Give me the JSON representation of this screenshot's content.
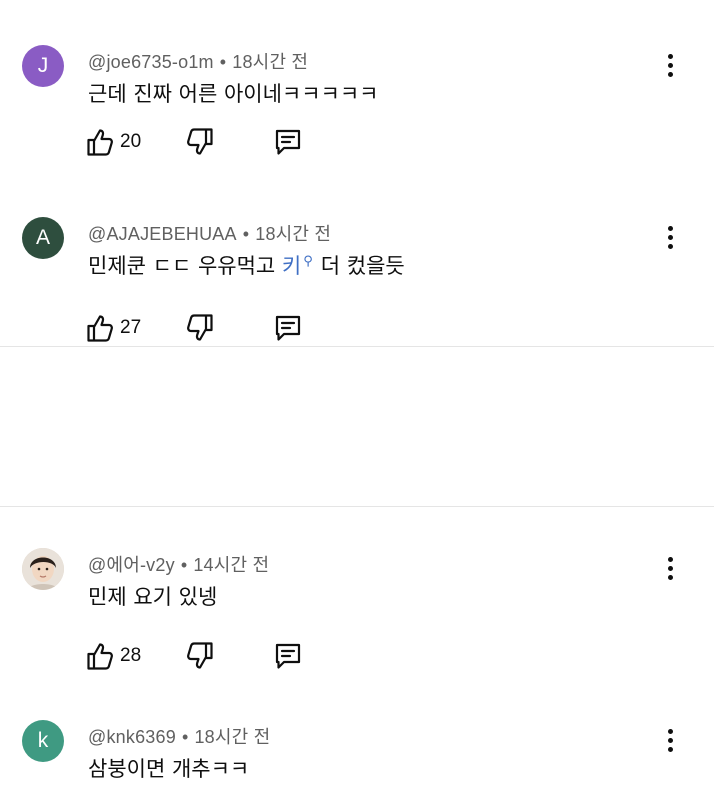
{
  "comments": [
    {
      "initial": "J",
      "avatar_color": "#8a5cc4",
      "handle": "@joe6735-o1m",
      "time": "18시간 전",
      "text": "근데 진짜 어른 아이네ㅋㅋㅋㅋㅋ",
      "likes": "20"
    },
    {
      "initial": "A",
      "avatar_color": "#2e4e3e",
      "handle": "@AJAJEBEHUAA",
      "time": "18시간 전",
      "text_before": "민제쿤 ㄷㄷ 우유먹고 ",
      "text_link": "키",
      "text_after": "더 컸을듯",
      "likes": "27"
    },
    {
      "initial": "",
      "avatar_color": "#d9c9b8",
      "handle": "@에어-v2y",
      "time": "14시간 전",
      "text": "민제 요기 있넹",
      "likes": "28"
    },
    {
      "initial": "k",
      "avatar_color": "#3f9a82",
      "handle": "@knk6369",
      "time": "18시간 전",
      "text": "삼붕이면 개추ㅋㅋ"
    }
  ],
  "separator": "•",
  "icons": {
    "like": "thumbs-up-icon",
    "dislike": "thumbs-down-icon",
    "reply": "reply-icon",
    "more": "more-vert-icon",
    "search": "search-icon"
  }
}
